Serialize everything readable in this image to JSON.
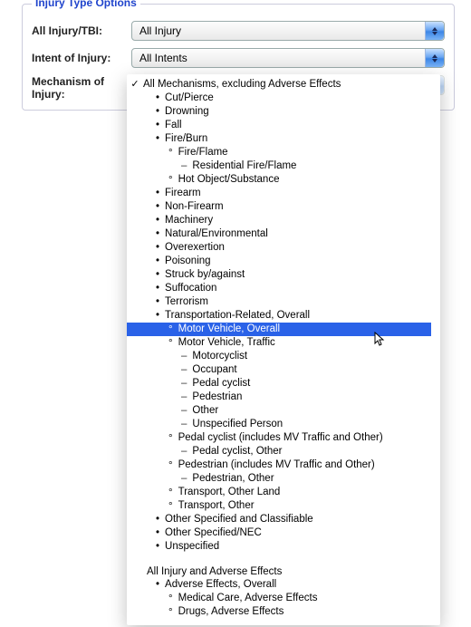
{
  "panel": {
    "legend": "Injury Type Options",
    "rows": {
      "allInjury": {
        "label": "All Injury/TBI:",
        "value": "All Injury"
      },
      "intent": {
        "label": "Intent of Injury:",
        "value": "All Intents"
      },
      "mechanism": {
        "label": "Mechanism of Injury:",
        "value": "All Mechanisms, excluding Adverse Effects"
      }
    }
  },
  "popup": {
    "items": [
      {
        "depth": 0,
        "bullet": "check",
        "label": "All Mechanisms, excluding Adverse Effects"
      },
      {
        "depth": 1,
        "bullet": "dot",
        "label": "Cut/Pierce"
      },
      {
        "depth": 1,
        "bullet": "dot",
        "label": "Drowning"
      },
      {
        "depth": 1,
        "bullet": "dot",
        "label": "Fall"
      },
      {
        "depth": 1,
        "bullet": "dot",
        "label": "Fire/Burn"
      },
      {
        "depth": 2,
        "bullet": "circ",
        "label": "Fire/Flame"
      },
      {
        "depth": 3,
        "bullet": "dash",
        "label": "Residential Fire/Flame"
      },
      {
        "depth": 2,
        "bullet": "circ",
        "label": "Hot Object/Substance"
      },
      {
        "depth": 1,
        "bullet": "dot",
        "label": "Firearm"
      },
      {
        "depth": 1,
        "bullet": "dot",
        "label": "Non-Firearm"
      },
      {
        "depth": 1,
        "bullet": "dot",
        "label": "Machinery"
      },
      {
        "depth": 1,
        "bullet": "dot",
        "label": "Natural/Environmental"
      },
      {
        "depth": 1,
        "bullet": "dot",
        "label": "Overexertion"
      },
      {
        "depth": 1,
        "bullet": "dot",
        "label": "Poisoning"
      },
      {
        "depth": 1,
        "bullet": "dot",
        "label": "Struck by/against"
      },
      {
        "depth": 1,
        "bullet": "dot",
        "label": "Suffocation"
      },
      {
        "depth": 1,
        "bullet": "dot",
        "label": "Terrorism"
      },
      {
        "depth": 1,
        "bullet": "dot",
        "label": "Transportation-Related, Overall"
      },
      {
        "depth": 2,
        "bullet": "circ",
        "label": "Motor Vehicle, Overall",
        "highlight": true
      },
      {
        "depth": 2,
        "bullet": "circ",
        "label": "Motor Vehicle, Traffic"
      },
      {
        "depth": 3,
        "bullet": "dash",
        "label": "Motorcyclist"
      },
      {
        "depth": 3,
        "bullet": "dash",
        "label": "Occupant"
      },
      {
        "depth": 3,
        "bullet": "dash",
        "label": "Pedal cyclist"
      },
      {
        "depth": 3,
        "bullet": "dash",
        "label": "Pedestrian"
      },
      {
        "depth": 3,
        "bullet": "dash",
        "label": "Other"
      },
      {
        "depth": 3,
        "bullet": "dash",
        "label": "Unspecified Person"
      },
      {
        "depth": 2,
        "bullet": "circ",
        "label": "Pedal cyclist (includes MV Traffic and Other)"
      },
      {
        "depth": 3,
        "bullet": "dash",
        "label": "Pedal cyclist, Other"
      },
      {
        "depth": 2,
        "bullet": "circ",
        "label": "Pedestrian (includes MV Traffic and Other)"
      },
      {
        "depth": 3,
        "bullet": "dash",
        "label": "Pedestrian, Other"
      },
      {
        "depth": 2,
        "bullet": "circ",
        "label": "Transport, Other Land"
      },
      {
        "depth": 2,
        "bullet": "circ",
        "label": "Transport, Other"
      },
      {
        "depth": 1,
        "bullet": "dot",
        "label": "Other Specified and Classifiable"
      },
      {
        "depth": 1,
        "bullet": "dot",
        "label": "Other Specified/NEC"
      },
      {
        "depth": 1,
        "bullet": "dot",
        "label": "Unspecified"
      }
    ],
    "section2_heading": "All Injury and Adverse Effects",
    "section2_items": [
      {
        "depth": 1,
        "bullet": "dot",
        "label": "Adverse Effects, Overall"
      },
      {
        "depth": 2,
        "bullet": "circ",
        "label": "Medical Care, Adverse Effects"
      },
      {
        "depth": 2,
        "bullet": "circ",
        "label": "Drugs, Adverse Effects"
      }
    ]
  }
}
